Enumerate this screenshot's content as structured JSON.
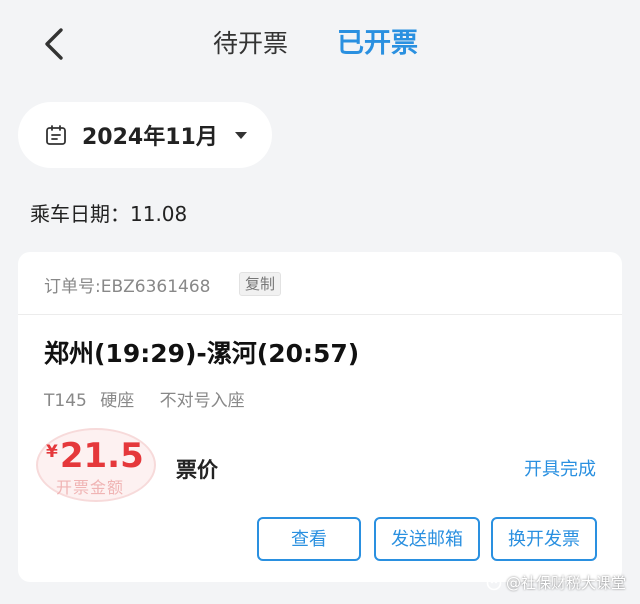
{
  "header": {
    "back_icon": "chevron-left-icon",
    "tabs": [
      {
        "label": "待开票",
        "active": false
      },
      {
        "label": "已开票",
        "active": true
      }
    ]
  },
  "filter": {
    "calendar_icon": "calendar-icon",
    "month": "2024年11月",
    "dropdown_icon": "caret-down-icon"
  },
  "ride_date": "乘车日期：11.08",
  "order": {
    "order_no": "订单号:EBZ6361468",
    "copy_label": "复制",
    "route": "郑州(19:29)-漯河(20:57)",
    "train_no": "T145",
    "seat_class": "硬座",
    "seat_note": "不对号入座",
    "price_currency": "¥",
    "price_value": "21.5",
    "stamp_text": "开票金额",
    "fare_label": "票价",
    "status": "开具完成",
    "actions": [
      {
        "label": "查看"
      },
      {
        "label": "发送邮箱"
      },
      {
        "label": "换开发票"
      }
    ]
  },
  "watermark": "@社保财税大课堂",
  "colors": {
    "accent": "#2a90e0",
    "price": "#e5383b",
    "background": "#f3f4f6"
  }
}
